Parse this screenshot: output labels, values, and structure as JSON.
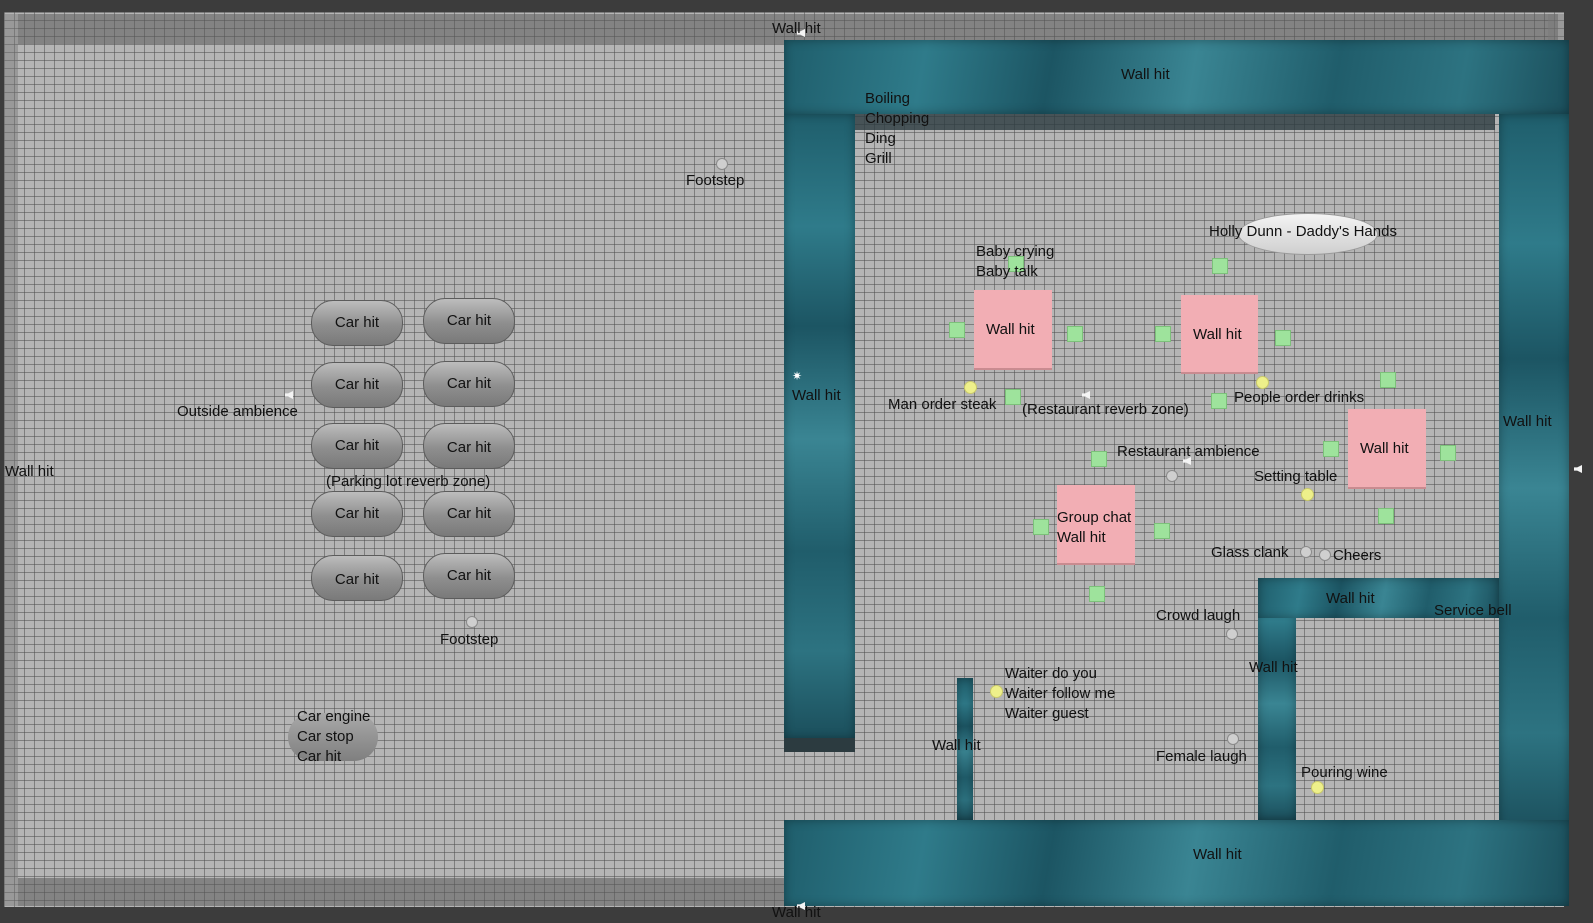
{
  "scene": {
    "outer_walls": {
      "top": "Wall hit",
      "bottom": "Wall hit",
      "left": "Wall hit"
    },
    "parking_lot": {
      "outside_ambience": "Outside ambience",
      "reverb_zone": "(Parking lot reverb zone)",
      "footstep_upper": "Footstep",
      "footstep_lower": "Footstep",
      "car_hits": [
        "Car hit",
        "Car hit",
        "Car hit",
        "Car hit",
        "Car hit",
        "Car hit",
        "Car hit",
        "Car hit",
        "Car hit",
        "Car hit"
      ],
      "car_sounds": [
        "Car engine",
        "Car stop",
        "Car hit"
      ]
    },
    "restaurant": {
      "walls": {
        "top": "Wall hit",
        "left": "Wall hit",
        "right": "Wall hit",
        "bottom": "Wall hit",
        "inner": "Wall hit",
        "service": "Wall hit",
        "service_top": "Wall hit"
      },
      "kitchen_sounds": [
        "Boiling",
        "Chopping",
        "Ding",
        "Grill"
      ],
      "music": "Holly Dunn - Daddy's Hands",
      "baby_sounds": [
        "Baby crying",
        "Baby talk"
      ],
      "man_order_steak": "Man order steak",
      "reverb_zone": "(Restaurant reverb zone)",
      "people_order_drinks": "People order drinks",
      "restaurant_ambience": "Restaurant ambience",
      "setting_table": "Setting table",
      "glass_clank": "Glass clank",
      "cheers": "Cheers",
      "crowd_laugh": "Crowd laugh",
      "female_laugh": "Female laugh",
      "pouring_wine": "Pouring wine",
      "service_bell": "Service bell",
      "waiter_lines": [
        "Waiter do you",
        "Waiter follow me",
        "Waiter guest"
      ],
      "tables": [
        {
          "lines": [
            "Wall hit"
          ]
        },
        {
          "lines": [
            "Wall hit"
          ]
        },
        {
          "lines": [
            "Wall hit"
          ]
        },
        {
          "lines": [
            "Group chat",
            "Wall hit"
          ]
        }
      ]
    }
  }
}
